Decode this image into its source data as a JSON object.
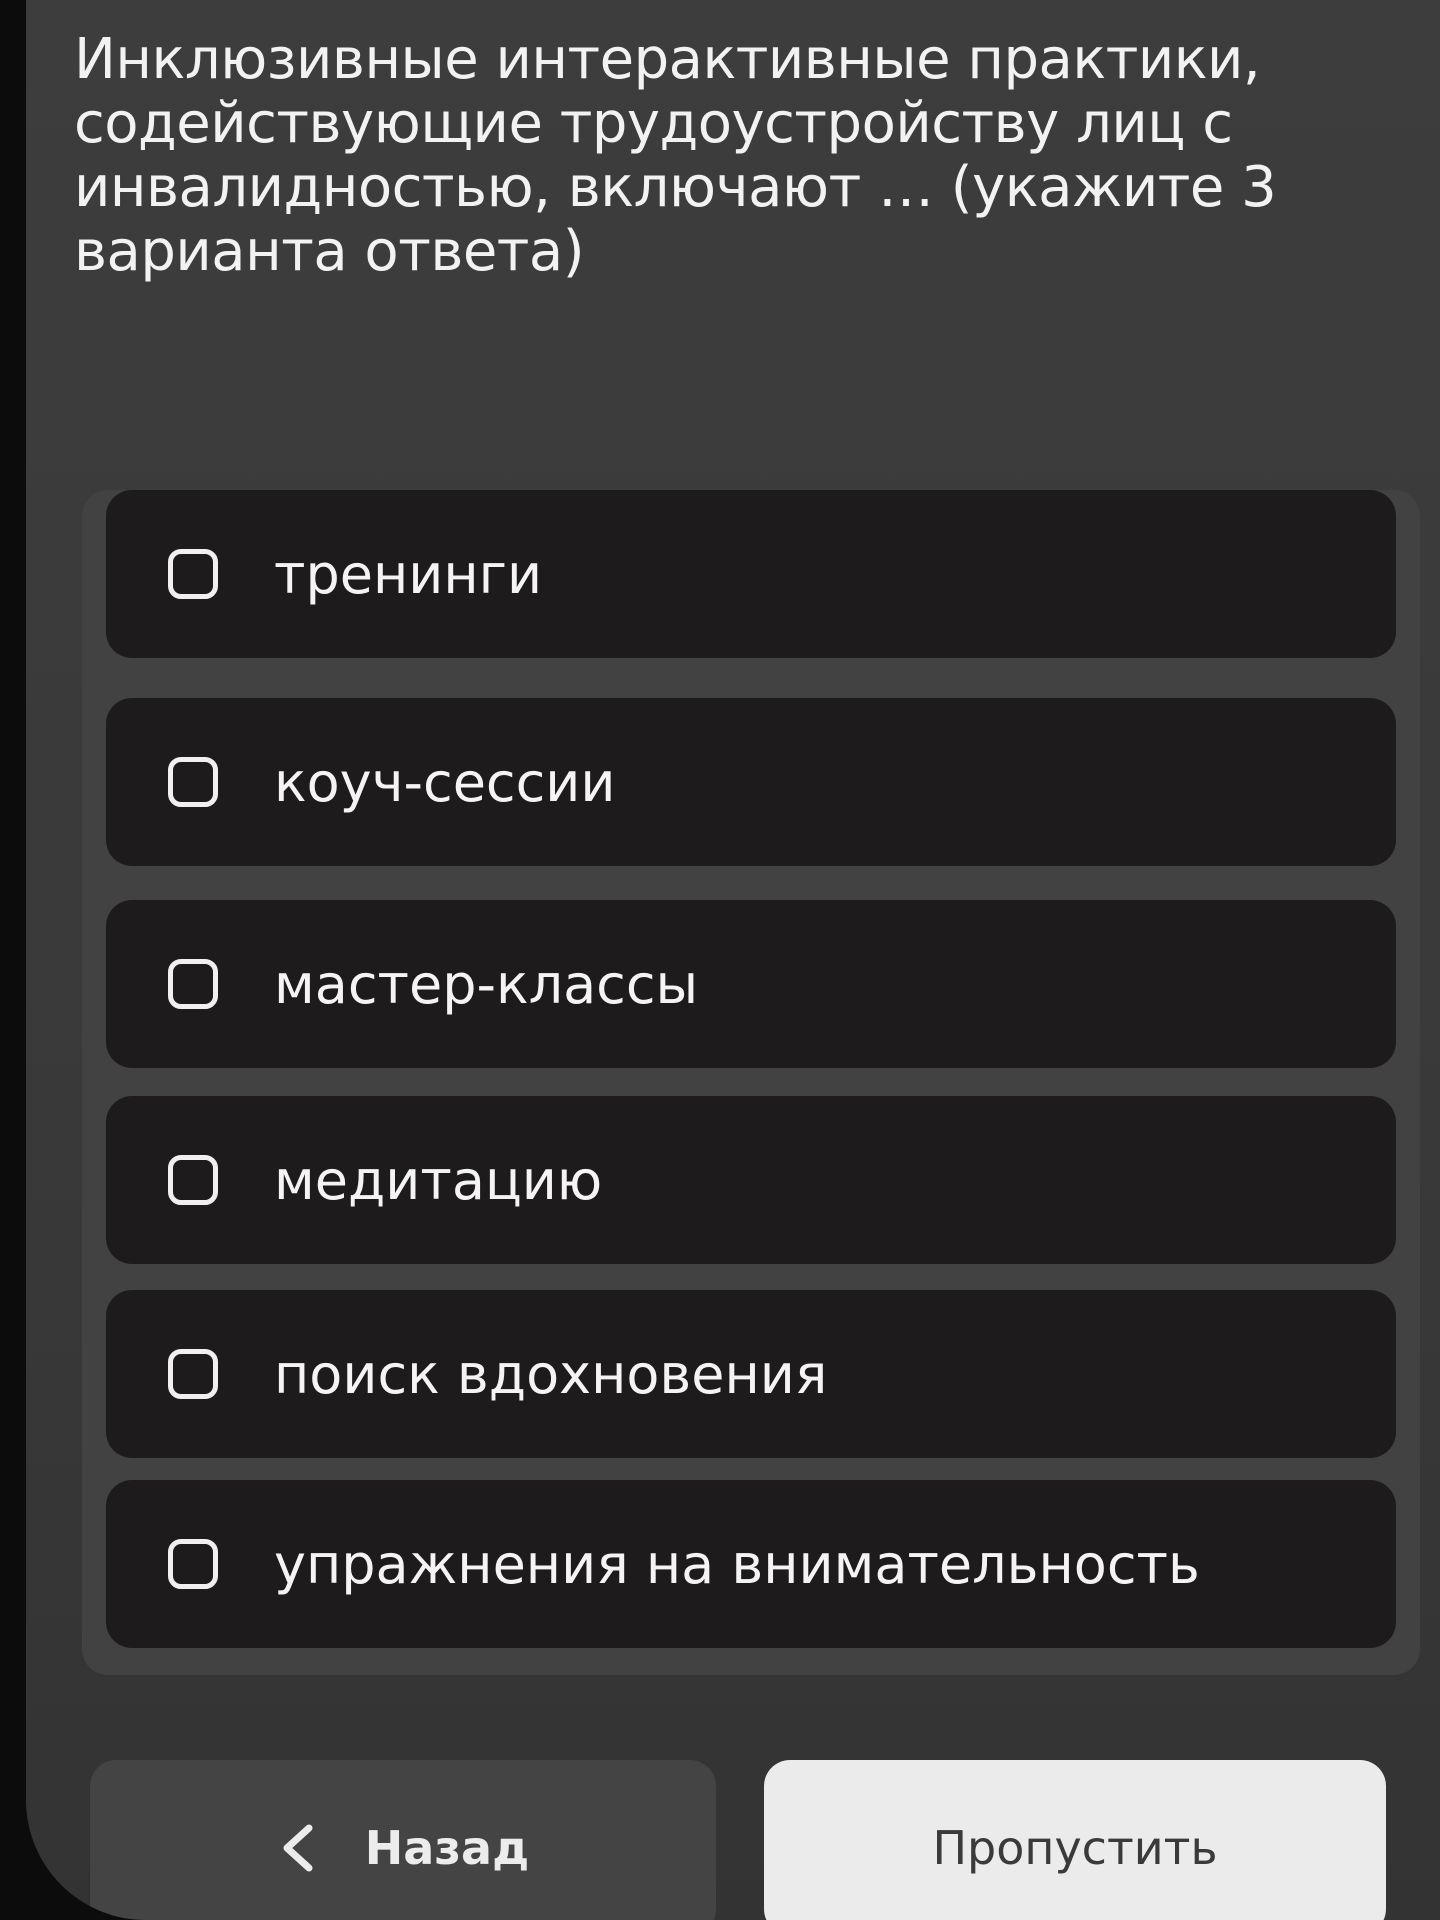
{
  "question": {
    "text": "Инклюзивные интерактивные практики, содействующие трудоустройству лиц с инвалидностью, включают … (укажите 3 варианта ответа)"
  },
  "options": [
    {
      "label": "тренинги",
      "checked": false
    },
    {
      "label": "коуч-сессии",
      "checked": false
    },
    {
      "label": "мастер-классы",
      "checked": false
    },
    {
      "label": "медитацию",
      "checked": false
    },
    {
      "label": "поиск вдохновения",
      "checked": false
    },
    {
      "label": "упражнения на внимательность",
      "checked": false
    }
  ],
  "footer": {
    "back_label": "Назад",
    "back_icon": "chevron-left-icon",
    "skip_label": "Пропустить"
  },
  "colors": {
    "background": "#3d3d3d",
    "option_bg": "#1d1b1c",
    "options_panel": "#424242",
    "text": "#f2f2f2",
    "skip_bg": "#ebebeb"
  }
}
